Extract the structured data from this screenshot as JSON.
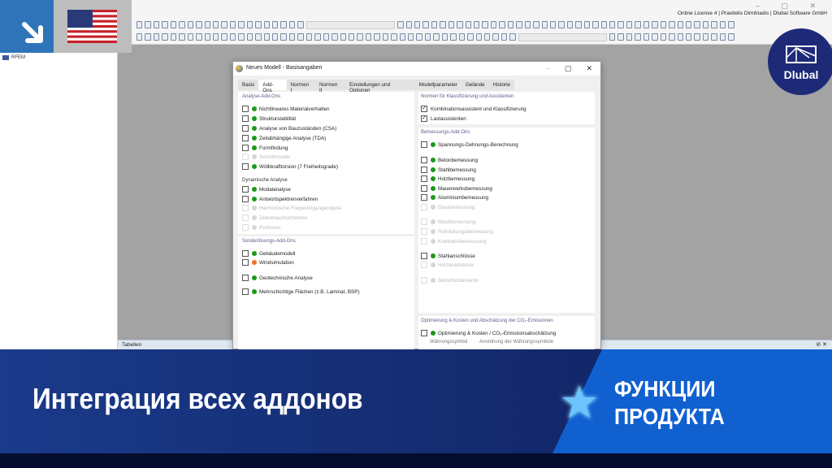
{
  "app": {
    "license": "Online License 4 | Praxitelis Dimitriadis | Dlubal Software GmbH",
    "window_controls": "– ▢ ✕",
    "navigator_root": "RFEM",
    "tables_label": "Tabellen"
  },
  "dialog": {
    "title": "Neues Modell - Basisangaben",
    "tabs": [
      "Basis",
      "Add-Ons",
      "Normen I",
      "Normen II",
      "Einstellungen und Optionen",
      "Modellparameter",
      "Gelände",
      "Historie"
    ],
    "active_tab": "Add-Ons",
    "groups": {
      "analyse": "Analyse-Add-Ons",
      "dynamisch": "Dynamische Analyse",
      "sonder": "Sonderlösungs-Add-Ons",
      "normen": "Normen für Klassifizierung und Assistenten",
      "bemessung": "Bemessungs-Add-Ons",
      "optimierung": "Optimierung & Kosten und Abschätzung der CO₂-Emissionen"
    },
    "left_items": [
      {
        "label": "Nichtlineares Materialverhalten",
        "status": "green",
        "checked": false,
        "enabled": true
      },
      {
        "label": "Strukturstabilität",
        "status": "green",
        "checked": false,
        "enabled": true
      },
      {
        "label": "Analyse von Bauzuständen (CSA)",
        "status": "green",
        "checked": false,
        "enabled": true
      },
      {
        "label": "Zeitabhängige Analyse (TDA)",
        "status": "green",
        "checked": false,
        "enabled": true
      },
      {
        "label": "Formfindung",
        "status": "green",
        "checked": false,
        "enabled": true
      },
      {
        "label": "Schnittmuster",
        "status": "gray",
        "checked": false,
        "enabled": false
      },
      {
        "label": "Wölbkrafttorsion (7 Freiheitsgrade)",
        "status": "green",
        "checked": false,
        "enabled": true
      },
      {
        "label": "Modalanalyse",
        "status": "green",
        "checked": false,
        "enabled": true
      },
      {
        "label": "Antwortspektrenverfahren",
        "status": "green",
        "checked": false,
        "enabled": true
      },
      {
        "label": "Harmonische Frequenzganganalyse",
        "status": "gray",
        "checked": false,
        "enabled": false
      },
      {
        "label": "Zeitverlaufsverfahren",
        "status": "gray",
        "checked": false,
        "enabled": false
      },
      {
        "label": "Pushover",
        "status": "gray",
        "checked": false,
        "enabled": false
      },
      {
        "label": "Gebäudemodell",
        "status": "green",
        "checked": false,
        "enabled": true
      },
      {
        "label": "Windsimulation",
        "status": "orange",
        "checked": false,
        "enabled": true
      },
      {
        "label": "Geotechnische Analyse",
        "status": "green",
        "checked": false,
        "enabled": true
      },
      {
        "label": "Mehrschichtige Flächen (z.B. Laminat, BSP)",
        "status": "green",
        "checked": false,
        "enabled": true
      }
    ],
    "right_items": [
      {
        "label": "Kombinationsassistent und Klassifizierung",
        "status": "none",
        "checked": true,
        "enabled": true
      },
      {
        "label": "Lastassistenten",
        "status": "none",
        "checked": true,
        "enabled": true
      },
      {
        "label": "Spannungs-Dehnungs-Berechnung",
        "status": "green",
        "checked": false,
        "enabled": true
      },
      {
        "label": "Betonbemessung",
        "status": "green",
        "checked": false,
        "enabled": true
      },
      {
        "label": "Stahlbemessung",
        "status": "green",
        "checked": false,
        "enabled": true
      },
      {
        "label": "Holzbemessung",
        "status": "green",
        "checked": false,
        "enabled": true
      },
      {
        "label": "Mauerwerksbemessung",
        "status": "green",
        "checked": false,
        "enabled": true
      },
      {
        "label": "Aluminiumbemessung",
        "status": "green",
        "checked": false,
        "enabled": true
      },
      {
        "label": "Glasbemessung",
        "status": "gray",
        "checked": false,
        "enabled": false
      },
      {
        "label": "Mastbemessung",
        "status": "gray",
        "checked": false,
        "enabled": false
      },
      {
        "label": "Rohrleitungsbemessung",
        "status": "gray",
        "checked": false,
        "enabled": false
      },
      {
        "label": "Kranbahnbemessung",
        "status": "gray",
        "checked": false,
        "enabled": false
      },
      {
        "label": "Stahlanschlüsse",
        "status": "green",
        "checked": false,
        "enabled": true
      },
      {
        "label": "Holzanschlüsse",
        "status": "gray",
        "checked": false,
        "enabled": false
      },
      {
        "label": "Betonfundamente",
        "status": "gray",
        "checked": false,
        "enabled": false
      },
      {
        "label": "Optimierung & Kosten / CO₂-Emissionsabschätzung",
        "status": "green",
        "checked": false,
        "enabled": true
      }
    ],
    "currency_symbol_label": "Währungssymbol",
    "currency_position_label": "Anordnung der Währungssymbole"
  },
  "banner": {
    "headline": "Интеграция всех аддонов",
    "category_line1": "ФУНКЦИИ",
    "category_line2": "ПРОДУКТА",
    "logo_text": "Dlubal"
  },
  "colors": {
    "green": "#1a9a1a",
    "orange": "#f07020",
    "gray": "#d6d6d6",
    "banner_dark": "#142a6e",
    "banner_accent": "#1060d0",
    "logo_bg": "#1e2a78"
  }
}
